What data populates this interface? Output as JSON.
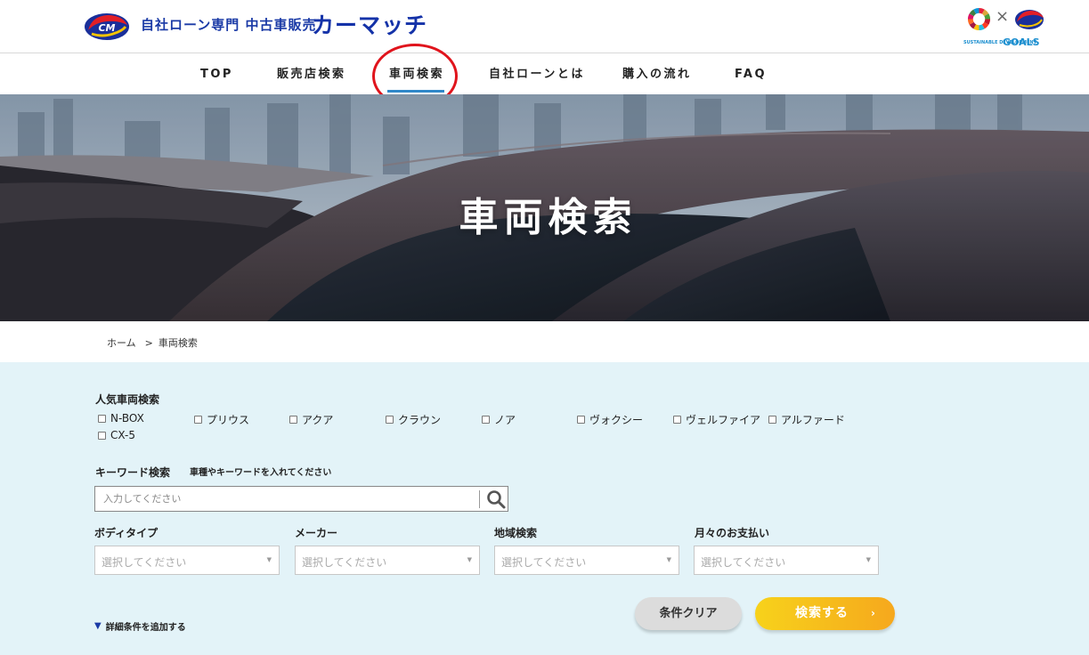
{
  "header": {
    "tagline": "自社ローン専門 中古車販売",
    "brand": "カーマッチ",
    "sdgs_small_text": "SUSTAINABLE DEVELOPMENT",
    "sdgs_goals_text": "GOALS",
    "sdgs_separator": "×"
  },
  "nav": {
    "items": [
      {
        "label": "TOP"
      },
      {
        "label": "販売店検索"
      },
      {
        "label": "車両検索",
        "active": true
      },
      {
        "label": "自社ローンとは"
      },
      {
        "label": "購入の流れ"
      },
      {
        "label": "FAQ"
      }
    ]
  },
  "hero": {
    "title": "車両検索"
  },
  "breadcrumb": {
    "home": "ホーム",
    "separator": ">",
    "current": "車両検索"
  },
  "search": {
    "popular_label": "人気車両検索",
    "popular_cars": [
      "N-BOX",
      "プリウス",
      "アクア",
      "クラウン",
      "ノア",
      "ヴォクシー",
      "ヴェルファイア",
      "アルファード",
      "CX-5"
    ],
    "keyword_label": "キーワード検索",
    "keyword_hint": "車種やキーワードを入れてください",
    "keyword_placeholder": "入力してください",
    "selects": [
      {
        "label": "ボディタイプ",
        "placeholder": "選択してください"
      },
      {
        "label": "メーカー",
        "placeholder": "選択してください"
      },
      {
        "label": "地域検索",
        "placeholder": "選択してください"
      },
      {
        "label": "月々のお支払い",
        "placeholder": "選択してください"
      }
    ],
    "clear_button": "条件クリア",
    "search_button": "検索する",
    "search_button_chevron": "›",
    "detail_toggle_icon": "▼",
    "detail_toggle": "詳細条件を追加する"
  },
  "colors": {
    "brand_blue": "#1432a8",
    "nav_active_underline": "#2f88c9",
    "highlight_circle": "#e0141c",
    "panel_bg": "#e3f3f8",
    "search_button_start": "#f7d21b",
    "search_button_end": "#f6a81d"
  }
}
